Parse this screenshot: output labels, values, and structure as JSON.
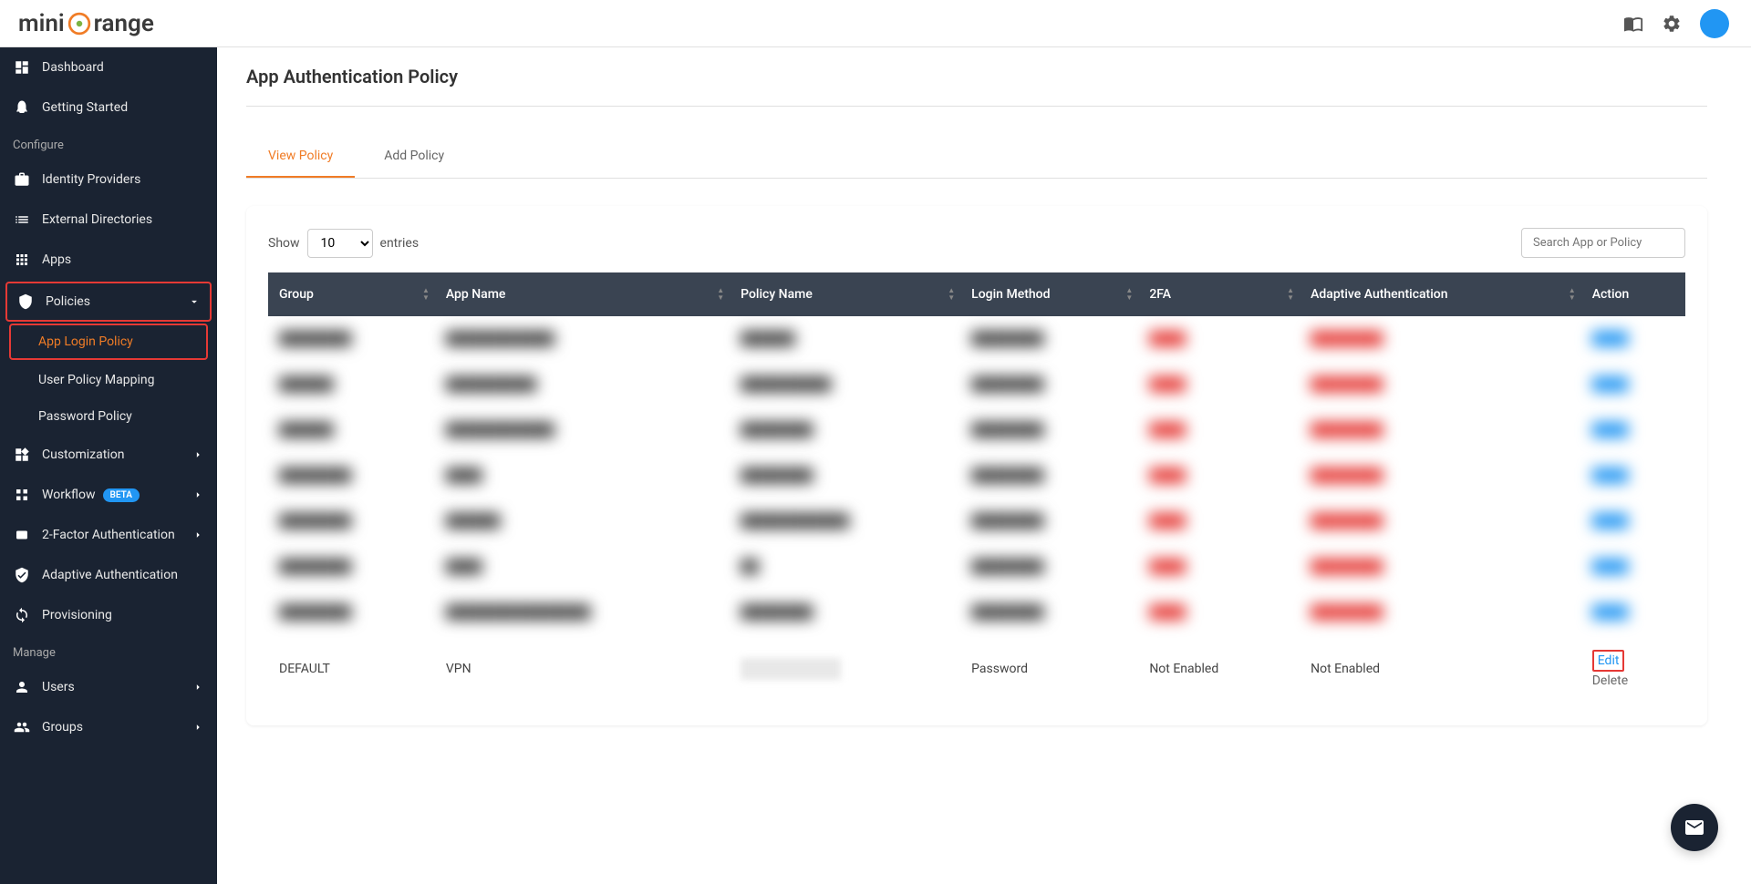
{
  "header": {
    "logo_pre": "mini",
    "logo_highlight": "",
    "logo_post": "range"
  },
  "sidebar": {
    "dashboard": "Dashboard",
    "getting_started": "Getting Started",
    "section_configure": "Configure",
    "identity_providers": "Identity Providers",
    "external_directories": "External Directories",
    "apps": "Apps",
    "policies": "Policies",
    "app_login_policy": "App Login Policy",
    "user_policy_mapping": "User Policy Mapping",
    "password_policy": "Password Policy",
    "customization": "Customization",
    "workflow": "Workflow",
    "beta": "BETA",
    "two_factor_auth": "2-Factor Authentication",
    "adaptive_auth": "Adaptive Authentication",
    "provisioning": "Provisioning",
    "section_manage": "Manage",
    "users": "Users",
    "groups": "Groups"
  },
  "main": {
    "title": "App Authentication Policy",
    "tabs": {
      "view": "View Policy",
      "add": "Add Policy"
    },
    "table": {
      "show_label": "Show",
      "entries_label": "entries",
      "entries_value": "10",
      "search_placeholder": "Search App or Policy",
      "headers": {
        "group": "Group",
        "app_name": "App Name",
        "policy_name": "Policy Name",
        "login_method": "Login Method",
        "twofa": "2FA",
        "adaptive_auth": "Adaptive Authentication",
        "action": "Action"
      },
      "last_row": {
        "group": "DEFAULT",
        "app_name": "VPN",
        "login_method": "Password",
        "twofa": "Not Enabled",
        "adaptive_auth": "Not Enabled",
        "edit": "Edit",
        "delete": "Delete"
      }
    }
  }
}
